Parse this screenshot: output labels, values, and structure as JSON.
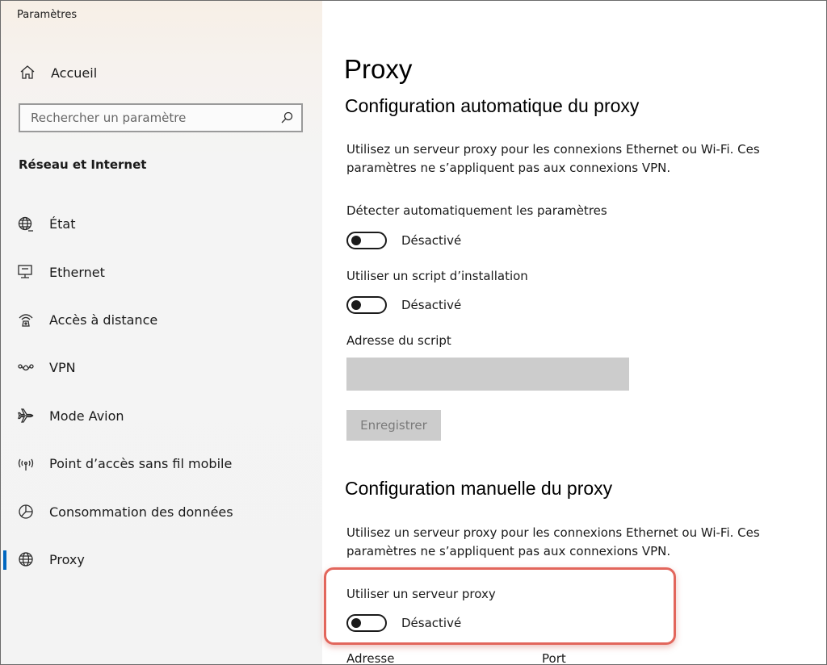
{
  "app": {
    "title": "Paramètres"
  },
  "sidebar": {
    "home_label": "Accueil",
    "search_placeholder": "Rechercher un paramètre",
    "section_title": "Réseau et Internet",
    "items": [
      {
        "label": "État",
        "icon": "globe-status-icon",
        "active": false
      },
      {
        "label": "Ethernet",
        "icon": "ethernet-icon",
        "active": false
      },
      {
        "label": "Accès à distance",
        "icon": "dialup-icon",
        "active": false
      },
      {
        "label": "VPN",
        "icon": "vpn-icon",
        "active": false
      },
      {
        "label": "Mode Avion",
        "icon": "airplane-icon",
        "active": false
      },
      {
        "label": "Point d’accès sans fil mobile",
        "icon": "hotspot-icon",
        "active": false
      },
      {
        "label": "Consommation des données",
        "icon": "data-usage-icon",
        "active": false
      },
      {
        "label": "Proxy",
        "icon": "globe-icon",
        "active": true
      }
    ]
  },
  "main": {
    "title": "Proxy",
    "auto": {
      "heading": "Configuration automatique du proxy",
      "description": "Utilisez un serveur proxy pour les connexions Ethernet ou Wi-Fi. Ces paramètres ne s’appliquent pas aux connexions VPN.",
      "detect_label": "Détecter automatiquement les paramètres",
      "detect_state": "Désactivé",
      "detect_on": false,
      "script_label": "Utiliser un script d’installation",
      "script_state": "Désactivé",
      "script_on": false,
      "address_label": "Adresse du script",
      "address_value": "",
      "save_label": "Enregistrer"
    },
    "manual": {
      "heading": "Configuration manuelle du proxy",
      "description": "Utilisez un serveur proxy pour les connexions Ethernet ou Wi-Fi. Ces paramètres ne s’appliquent pas aux connexions VPN.",
      "use_proxy_label": "Utiliser un serveur proxy",
      "use_proxy_state": "Désactivé",
      "use_proxy_on": false,
      "address_label": "Adresse",
      "port_label": "Port"
    }
  },
  "colors": {
    "accent": "#0067c0",
    "highlight": "#e2665c",
    "disabled": "#cccccc"
  }
}
